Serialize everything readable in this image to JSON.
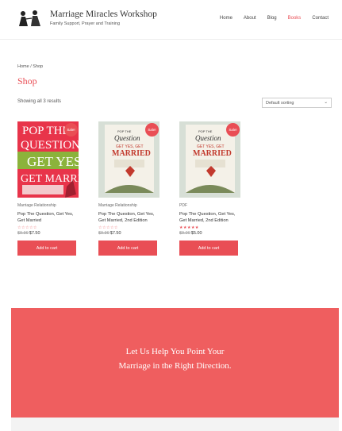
{
  "header": {
    "site_title": "Marriage Miracles Workshop",
    "tagline": "Family Support, Prayer and Training",
    "nav": [
      "Home",
      "About",
      "Blog",
      "Books",
      "Contact"
    ]
  },
  "breadcrumb": "Home / Shop",
  "page_title": "Shop",
  "result_count": "Showing all 3 results",
  "ordering": {
    "selected": "Default sorting",
    "chevron": "⌄"
  },
  "products": [
    {
      "badge": "Sale!",
      "category": "Marriage Relationship",
      "title": "Pop The Question, Get Yes, Get Married",
      "stars": "☆☆☆☆☆",
      "old_price": "$9.99",
      "price": "$7.50",
      "button": "Add to cart"
    },
    {
      "badge": "Sale!",
      "category": "Marriage Relationship",
      "title": "Pop The Question, Get Yes, Get Married, 2nd Edition",
      "stars": "☆☆☆☆☆",
      "old_price": "$9.99",
      "price": "$7.50",
      "button": "Add to cart"
    },
    {
      "badge": "Sale!",
      "category": "PDF",
      "title": "Pop The Question, Get Yes, Get Married, 2nd Edition",
      "stars": "★★★★★",
      "old_price": "$9.00",
      "price": "$5.00",
      "button": "Add to cart"
    }
  ],
  "cta": {
    "line1": "Let Us Help You Point Your",
    "line2": "Marriage in the Right Direction."
  },
  "colors": {
    "accent": "#e94e55",
    "cta_bg": "#ef5e5f"
  }
}
